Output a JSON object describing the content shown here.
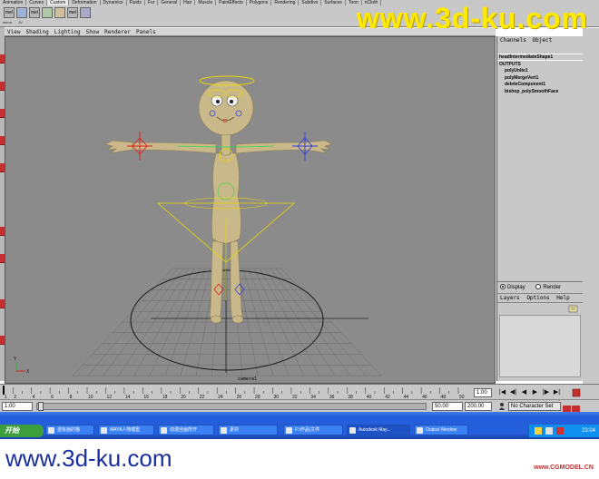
{
  "shelf": {
    "tabs": [
      "Animation",
      "Curves",
      "Custom",
      "Deformation",
      "Dynamics",
      "Fluids",
      "Fur",
      "General",
      "Hair",
      "Muscle",
      "PaintEffects",
      "Polygons",
      "Rendering",
      "Subdivs",
      "Surfaces",
      "Toon",
      "nCloth"
    ],
    "active_tab": "Custom",
    "buttons": [
      {
        "label": "mel",
        "caption": "mirror"
      },
      {
        "label": "",
        "caption": "JV"
      },
      {
        "label": "mel",
        "caption": ""
      },
      {
        "label": "",
        "caption": ""
      },
      {
        "label": "",
        "caption": ""
      },
      {
        "label": "mel",
        "caption": ""
      },
      {
        "label": "",
        "caption": ""
      }
    ]
  },
  "watermark_top": "www.3d-ku.com",
  "panel_menu": [
    "View",
    "Shading",
    "Lighting",
    "Show",
    "Renderer",
    "Panels"
  ],
  "viewport": {
    "camera_label": "camera1",
    "axis_y": "Y",
    "axis_x": "X",
    "colors": {
      "background": "#8b8b8b",
      "grid": "#6c6c6c",
      "character": "#c9b98a",
      "joint_yellow": "#e8d800",
      "joint_green": "#3ad84a",
      "ik_blue": "#3040e0",
      "ik_red": "#e02020"
    }
  },
  "channel_box": {
    "tabs": [
      "Channels",
      "Object"
    ],
    "node": "headIntermediateShape1",
    "outputs_label": "OUTPUTS",
    "items": [
      "polyUnite1",
      "polyMergeVert1",
      "deleteComponent1",
      "bishop_polySmoothFace"
    ]
  },
  "layer_editor": {
    "display_label": "Display",
    "render_label": "Render",
    "selected": "Display",
    "menu": [
      "Layers",
      "Options",
      "Help"
    ]
  },
  "time_slider": {
    "ticks": [
      1,
      2,
      4,
      6,
      8,
      10,
      12,
      14,
      16,
      18,
      20,
      22,
      24,
      26,
      28,
      30,
      32,
      34,
      36,
      38,
      40,
      42,
      44,
      46,
      48,
      50
    ],
    "min": 1,
    "max": 50,
    "current_frame": "1.00"
  },
  "playback": {
    "buttons": [
      "|◀",
      "◀|",
      "◀",
      "▶",
      "|▶",
      "▶|"
    ]
  },
  "range": {
    "start": "1.00",
    "range_start": "1.00",
    "range_end": "50.00",
    "end": "200.00",
    "character_set": "No Character Set"
  },
  "taskbar": {
    "start_label": "开始",
    "tasks": [
      {
        "label": "遗有画的猫",
        "active": false
      },
      {
        "label": "MAYA人物模型",
        "active": false
      },
      {
        "label": "动漫丝画所开",
        "active": false
      },
      {
        "label": "素材",
        "active": false
      },
      {
        "label": "F:\\作品\\文件",
        "active": false
      },
      {
        "label": "Autodesk May...",
        "active": true
      },
      {
        "label": "Output Window",
        "active": false
      }
    ],
    "clock": "23:04"
  },
  "watermark_bottom": "www.3d-ku.com",
  "watermark_small": "www.CGMODEL.CN"
}
